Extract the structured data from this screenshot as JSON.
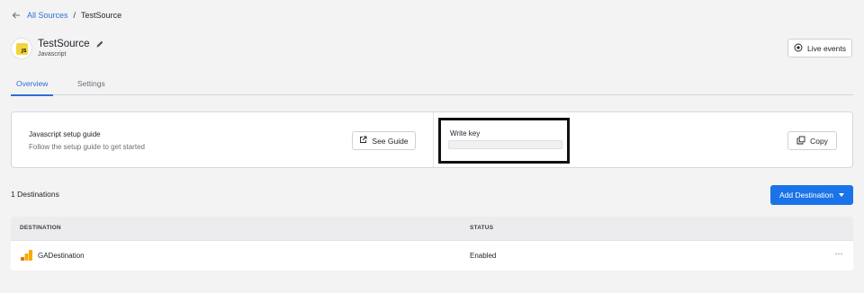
{
  "breadcrumb": {
    "parent": "All Sources",
    "separator": "/",
    "current": "TestSource"
  },
  "source": {
    "name": "TestSource",
    "type": "Javascript",
    "logo_text": "JS"
  },
  "header": {
    "live_events_label": "Live events"
  },
  "tabs": [
    {
      "label": "Overview",
      "active": true
    },
    {
      "label": "Settings",
      "active": false
    }
  ],
  "setup": {
    "guide_title": "Javascript setup guide",
    "guide_subtitle": "Follow the setup guide to get started",
    "see_guide_label": "See Guide",
    "write_key_label": "Write key",
    "copy_label": "Copy"
  },
  "destinations": {
    "count_label": "1 Destinations",
    "add_label": "Add Destination",
    "columns": [
      "DESTINATION",
      "STATUS"
    ],
    "rows": [
      {
        "name": "GADestination",
        "status": "Enabled"
      }
    ]
  },
  "colors": {
    "accent": "#1a73e8",
    "link": "#2f6fd6",
    "background": "#f3f3f4",
    "ga_orange": "#f9ab00",
    "ga_dark": "#e37400",
    "js_yellow": "#f3d43b"
  },
  "icons": [
    "arrow-left-icon",
    "edit-pencil-icon",
    "live-events-icon",
    "external-link-icon",
    "copy-icon",
    "caret-down-icon",
    "google-analytics-icon",
    "more-options-icon"
  ]
}
